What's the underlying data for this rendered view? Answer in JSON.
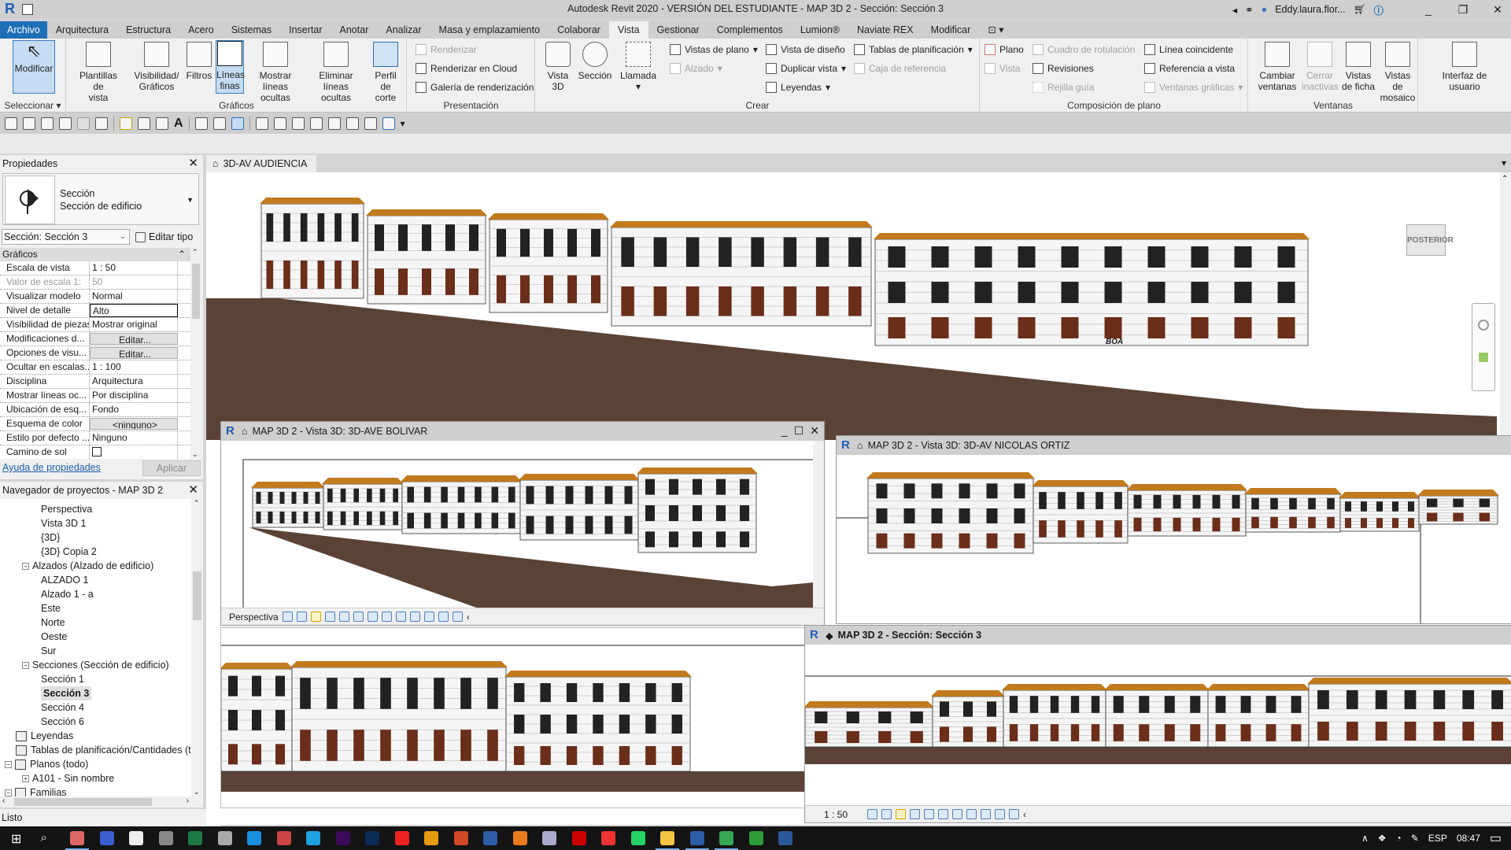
{
  "app": {
    "title": "Autodesk Revit 2020 - VERSIÓN DEL ESTUDIANTE - MAP 3D 2 - Sección: Sección 3",
    "user": "Eddy.laura.flor...",
    "status": "Listo"
  },
  "tabs": [
    {
      "label": "Archivo"
    },
    {
      "label": "Arquitectura"
    },
    {
      "label": "Estructura"
    },
    {
      "label": "Acero"
    },
    {
      "label": "Sistemas"
    },
    {
      "label": "Insertar"
    },
    {
      "label": "Anotar"
    },
    {
      "label": "Analizar"
    },
    {
      "label": "Masa y emplazamiento"
    },
    {
      "label": "Colaborar"
    },
    {
      "label": "Vista",
      "active": true
    },
    {
      "label": "Gestionar"
    },
    {
      "label": "Complementos"
    },
    {
      "label": "Lumion®"
    },
    {
      "label": "Naviate REX"
    },
    {
      "label": "Modificar"
    }
  ],
  "ribbon": {
    "seleccionar": {
      "modify": "Modificar",
      "label": "Seleccionar"
    },
    "graficos": {
      "label": "Gráficos",
      "buttons": [
        {
          "l1": "Plantillas de",
          "l2": "vista"
        },
        {
          "l1": "Visibilidad/",
          "l2": "Gráficos"
        },
        {
          "l1": "Filtros",
          "l2": ""
        },
        {
          "l1": "Líneas",
          "l2": "finas"
        },
        {
          "l1": "Mostrar",
          "l2": "líneas ocultas"
        },
        {
          "l1": "Eliminar",
          "l2": "líneas ocultas"
        },
        {
          "l1": "Perfil de",
          "l2": "corte"
        }
      ]
    },
    "presentacion": {
      "label": "Presentación",
      "items": [
        "Renderizar",
        "Renderizar  en Cloud",
        "Galería de  renderización"
      ]
    },
    "crear": {
      "label": "Crear",
      "big": [
        {
          "l1": "Vista",
          "l2": "3D"
        },
        {
          "l1": "Sección",
          "l2": ""
        },
        {
          "l1": "Llamada",
          "l2": ""
        }
      ],
      "items": [
        "Vistas de plano",
        "Alzado",
        "Vista de diseño",
        "Duplicar vista",
        "Leyendas",
        "Tablas de planificación",
        "Caja de referencia"
      ]
    },
    "composicion": {
      "label": "Composición de plano",
      "items": [
        "Plano",
        "Vista",
        "Cuadro de rotulación",
        "Revisiones",
        "Rejilla guía",
        "Línea coincidente",
        "Referencia a vista",
        "Ventanas gráficas"
      ]
    },
    "ventanas": {
      "label": "Ventanas",
      "buttons": [
        {
          "l1": "Cambiar",
          "l2": "ventanas"
        },
        {
          "l1": "Cerrar",
          "l2": "inactivas"
        },
        {
          "l1": "Vistas",
          "l2": "de ficha"
        },
        {
          "l1": "Vistas",
          "l2": "de mosaico"
        }
      ]
    },
    "ui": {
      "l1": "Interfaz de",
      "l2": "usuario"
    }
  },
  "properties": {
    "title": "Propiedades",
    "type_name": "Sección",
    "type_family": "Sección de edificio",
    "instance": "Sección: Sección 3",
    "edit_type": "Editar tipo",
    "group": "Gráficos",
    "rows": [
      {
        "k": "Escala de vista",
        "v": "1 : 50"
      },
      {
        "k": "Valor de escala    1:",
        "v": "50",
        "dim": true
      },
      {
        "k": "Visualizar modelo",
        "v": "Normal"
      },
      {
        "k": "Nivel de detalle",
        "v": "Alto",
        "box": true
      },
      {
        "k": "Visibilidad de piezas",
        "v": "Mostrar original"
      },
      {
        "k": "Modificaciones d...",
        "v": "Editar...",
        "btn": true
      },
      {
        "k": "Opciones de visu...",
        "v": "Editar...",
        "btn": true
      },
      {
        "k": "Ocultar en escalas...",
        "v": "1 : 100"
      },
      {
        "k": "Disciplina",
        "v": "Arquitectura"
      },
      {
        "k": "Mostrar líneas oc...",
        "v": "Por disciplina"
      },
      {
        "k": "Ubicación de esq...",
        "v": "Fondo"
      },
      {
        "k": "Esquema de color",
        "v": "<ninguno>",
        "btn": true
      },
      {
        "k": "Estilo por defecto ...",
        "v": "Ninguno"
      },
      {
        "k": "Camino de sol",
        "v": "",
        "check": false
      }
    ],
    "help": "Ayuda de propiedades",
    "apply": "Aplicar"
  },
  "browser": {
    "title": "Navegador de proyectos - MAP 3D 2",
    "nodes": [
      {
        "label": "Perspectiva",
        "level": 3
      },
      {
        "label": "Vista 3D 1",
        "level": 3
      },
      {
        "label": "{3D}",
        "level": 3
      },
      {
        "label": "{3D} Copia 2",
        "level": 3
      },
      {
        "label": "Alzados (Alzado de edificio)",
        "level": 2,
        "toggle": "−"
      },
      {
        "label": "ALZADO 1",
        "level": 3
      },
      {
        "label": "Alzado 1 - a",
        "level": 3
      },
      {
        "label": "Este",
        "level": 3
      },
      {
        "label": "Norte",
        "level": 3
      },
      {
        "label": "Oeste",
        "level": 3
      },
      {
        "label": "Sur",
        "level": 3
      },
      {
        "label": "Secciones (Sección de edificio)",
        "level": 2,
        "toggle": "−"
      },
      {
        "label": "Sección 1",
        "level": 3
      },
      {
        "label": "Sección 3",
        "level": 3,
        "selected": true
      },
      {
        "label": "Sección 4",
        "level": 3
      },
      {
        "label": "Sección 6",
        "level": 3
      },
      {
        "label": "Leyendas",
        "level": 1,
        "icon": true
      },
      {
        "label": "Tablas de planificación/Cantidades (to",
        "level": 1,
        "icon": true
      },
      {
        "label": "Planos (todo)",
        "level": 0,
        "toggle": "−",
        "icon": true
      },
      {
        "label": "A101 - Sin nombre",
        "level": 2,
        "toggle": "+"
      },
      {
        "label": "Familias",
        "level": 0,
        "toggle": "−",
        "icon": true
      }
    ]
  },
  "views": {
    "main_tab": "3D-AV AUDIENCIA",
    "viewcube": "POSTERIOR",
    "sign": "BOA",
    "bolivar": {
      "title": "MAP 3D 2 - Vista 3D: 3D-AVE BOLIVAR",
      "mode": "Perspectiva"
    },
    "ortiz": {
      "title": "MAP 3D 2 - Vista 3D: 3D-AV NICOLAS ORTIZ"
    },
    "seccion": {
      "title": "MAP 3D 2 - Sección: Sección 3",
      "scale": "1 : 50"
    }
  },
  "taskbar": {
    "lang": "ESP",
    "time": "08:47",
    "apps": [
      "start",
      "search",
      "paint",
      "app-blue",
      "sketch",
      "app-gray",
      "excel",
      "camera",
      "cortana",
      "app-red",
      "edge",
      "premiere",
      "photoshop",
      "acrobat",
      "media",
      "powerpoint",
      "revit",
      "app-orange",
      "notepad",
      "acrobat-2",
      "app-red-2",
      "whatsapp",
      "explorer",
      "revit-active",
      "chrome",
      "camtasia",
      "word"
    ]
  },
  "colors": {
    "file_tab": "#1e6fb8",
    "roof": "#c27a1e",
    "ground": "#5a4336",
    "selected_btn": "#c5dcf2"
  }
}
